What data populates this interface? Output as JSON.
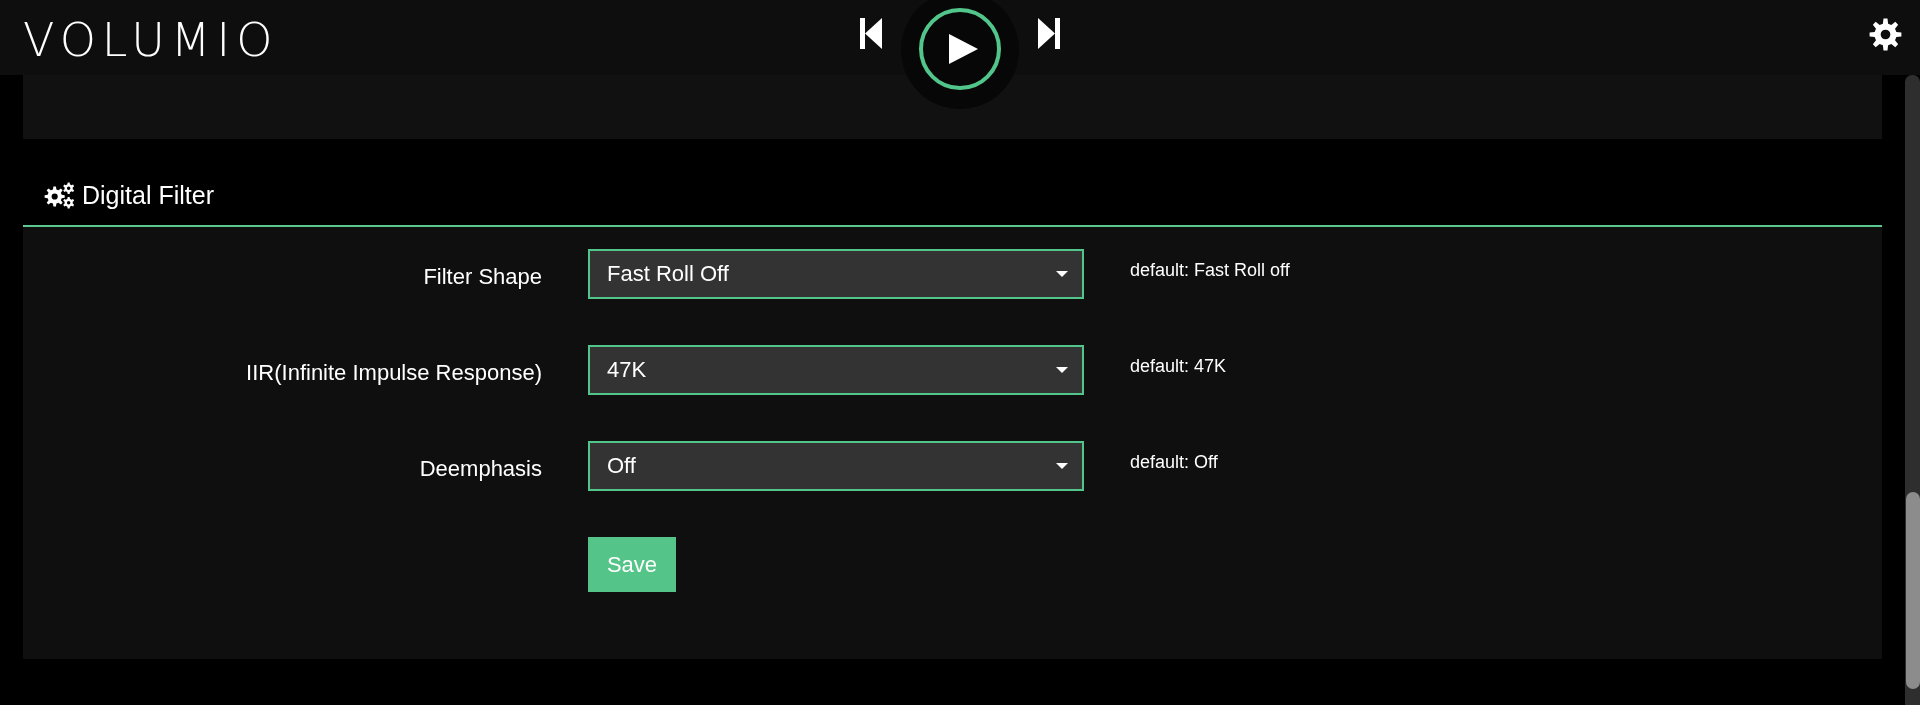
{
  "header": {
    "logo": "VOLUMIO",
    "player": {
      "playing": false
    }
  },
  "section": {
    "title": "Digital Filter",
    "fields": [
      {
        "label": "Filter Shape",
        "value": "Fast Roll Off",
        "default": "default: Fast Roll off"
      },
      {
        "label": "IIR(Infinite Impulse Response)",
        "value": "47K",
        "default": "default: 47K"
      },
      {
        "label": "Deemphasis",
        "value": "Off",
        "default": "default: Off"
      }
    ],
    "save": "Save"
  }
}
